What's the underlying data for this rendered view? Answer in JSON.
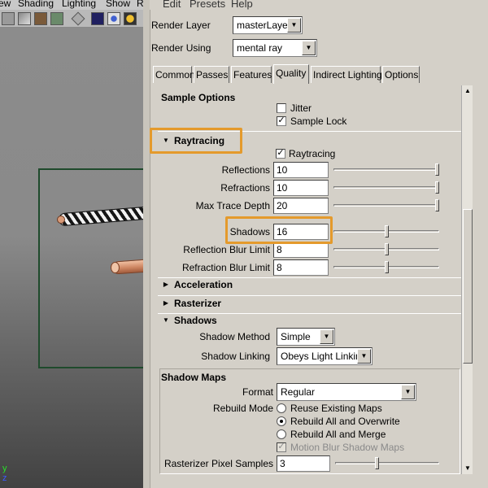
{
  "viewport_menu": [
    "ew",
    "Shading",
    "Lighting",
    "Show",
    "R"
  ],
  "viewport_axes": {
    "y": "y",
    "z": "z"
  },
  "menubar": [
    "Edit",
    "Presets",
    "Help"
  ],
  "render_layer": {
    "label": "Render Layer",
    "value": "masterLayer"
  },
  "render_using": {
    "label": "Render Using",
    "value": "mental ray"
  },
  "tabs": [
    "Common",
    "Passes",
    "Features",
    "Quality",
    "Indirect Lighting",
    "Options"
  ],
  "active_tab": "Quality",
  "sample_options": {
    "title": "Sample Options",
    "jitter": {
      "label": "Jitter",
      "checked": false
    },
    "sample_lock": {
      "label": "Sample Lock",
      "checked": true
    }
  },
  "raytracing": {
    "title": "Raytracing",
    "enable": {
      "label": "Raytracing",
      "checked": true
    },
    "reflections": {
      "label": "Reflections",
      "value": "10",
      "level": 1.0
    },
    "refractions": {
      "label": "Refractions",
      "value": "10",
      "level": 1.0
    },
    "max_trace_depth": {
      "label": "Max Trace Depth",
      "value": "20",
      "level": 1.0
    },
    "shadows": {
      "label": "Shadows",
      "value": "16",
      "level": 0.5
    },
    "reflection_blur_limit": {
      "label": "Reflection Blur Limit",
      "value": "8",
      "level": 0.5
    },
    "refraction_blur_limit": {
      "label": "Refraction Blur Limit",
      "value": "8",
      "level": 0.5
    }
  },
  "acceleration": {
    "title": "Acceleration"
  },
  "rasterizer": {
    "title": "Rasterizer"
  },
  "shadows": {
    "title": "Shadows",
    "shadow_method": {
      "label": "Shadow Method",
      "value": "Simple"
    },
    "shadow_linking": {
      "label": "Shadow Linking",
      "value": "Obeys Light Linking"
    }
  },
  "shadow_maps": {
    "title": "Shadow Maps",
    "format": {
      "label": "Format",
      "value": "Regular"
    },
    "rebuild_mode": {
      "label": "Rebuild Mode",
      "options": [
        "Reuse Existing Maps",
        "Rebuild All and Overwrite",
        "Rebuild All and Merge"
      ],
      "selected": "Rebuild All and Overwrite"
    },
    "motion_blur": {
      "label": "Motion Blur Shadow Maps",
      "checked": true,
      "disabled": true
    },
    "rasterizer_pixel_samples": {
      "label": "Rasterizer Pixel Samples",
      "value": "3",
      "level": 0.4
    }
  },
  "colors": {
    "highlight": "#e49a2c",
    "panel_bg": "#d4d0c8"
  },
  "icons": {
    "expanded": "triangle-down-icon",
    "collapsed": "triangle-right-icon",
    "check": "checkmark-icon"
  }
}
